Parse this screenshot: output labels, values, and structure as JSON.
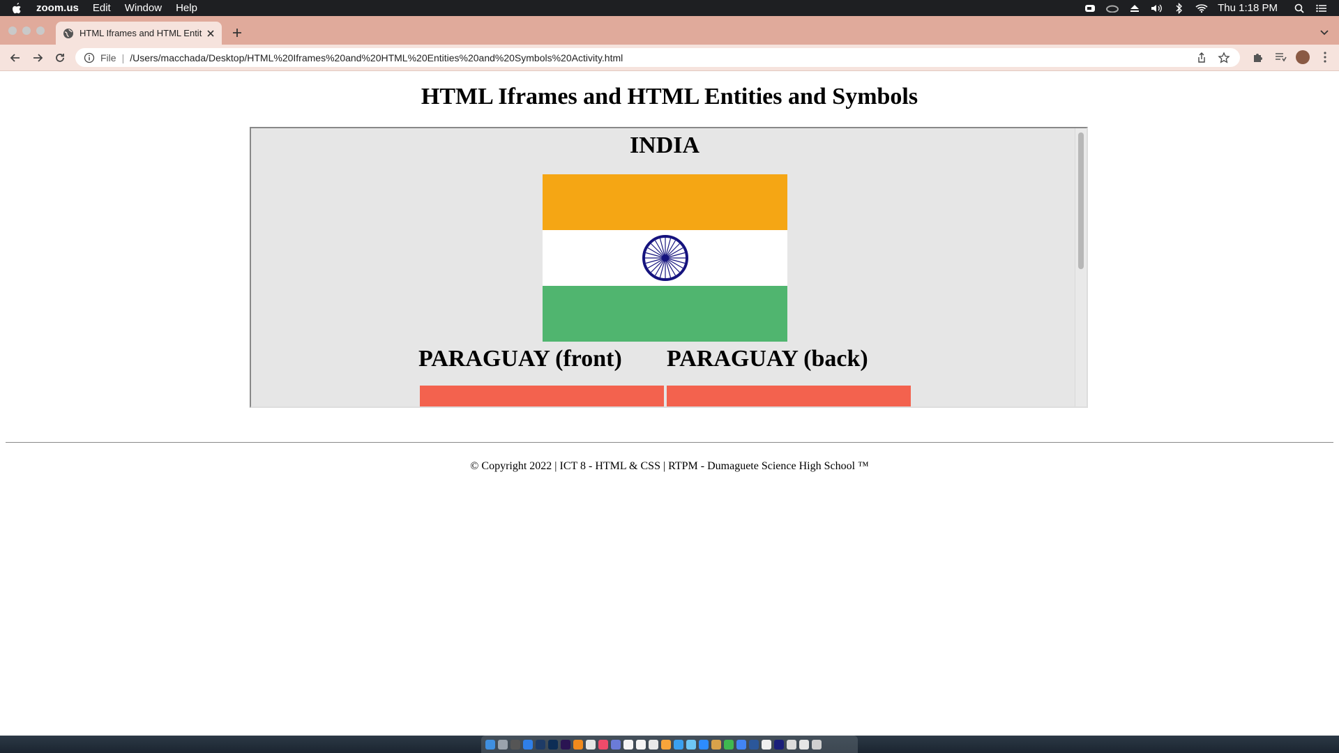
{
  "menubar": {
    "app": "zoom.us",
    "menus": [
      "Edit",
      "Window",
      "Help"
    ],
    "clock": "Thu 1:18 PM",
    "tray_icons": [
      "zoom-icon",
      "creative-cloud-icon",
      "eject-icon",
      "volume-icon",
      "bluetooth-icon",
      "wifi-icon"
    ]
  },
  "browser": {
    "tab_title": "HTML Iframes and HTML Entiti",
    "address_scheme": "File",
    "address_url": "/Users/macchada/Desktop/HTML%20Iframes%20and%20HTML%20Entities%20and%20Symbols%20Activity.html",
    "theme_color": "#e0aa9b"
  },
  "page": {
    "heading": "HTML Iframes and HTML Entities and Symbols",
    "iframe": {
      "india_title": "INDIA",
      "paraguay_front": "PARAGUAY (front)",
      "paraguay_back": "PARAGUAY (back)",
      "colors": {
        "saffron": "#f5a614",
        "white": "#ffffff",
        "green": "#50b56f",
        "chakra": "#15137e",
        "paraguay_red": "#f3624e"
      }
    },
    "footer": "© Copyright 2022 | ICT 8 - HTML & CSS | RTPM - Dumaguete Science High School ™"
  }
}
